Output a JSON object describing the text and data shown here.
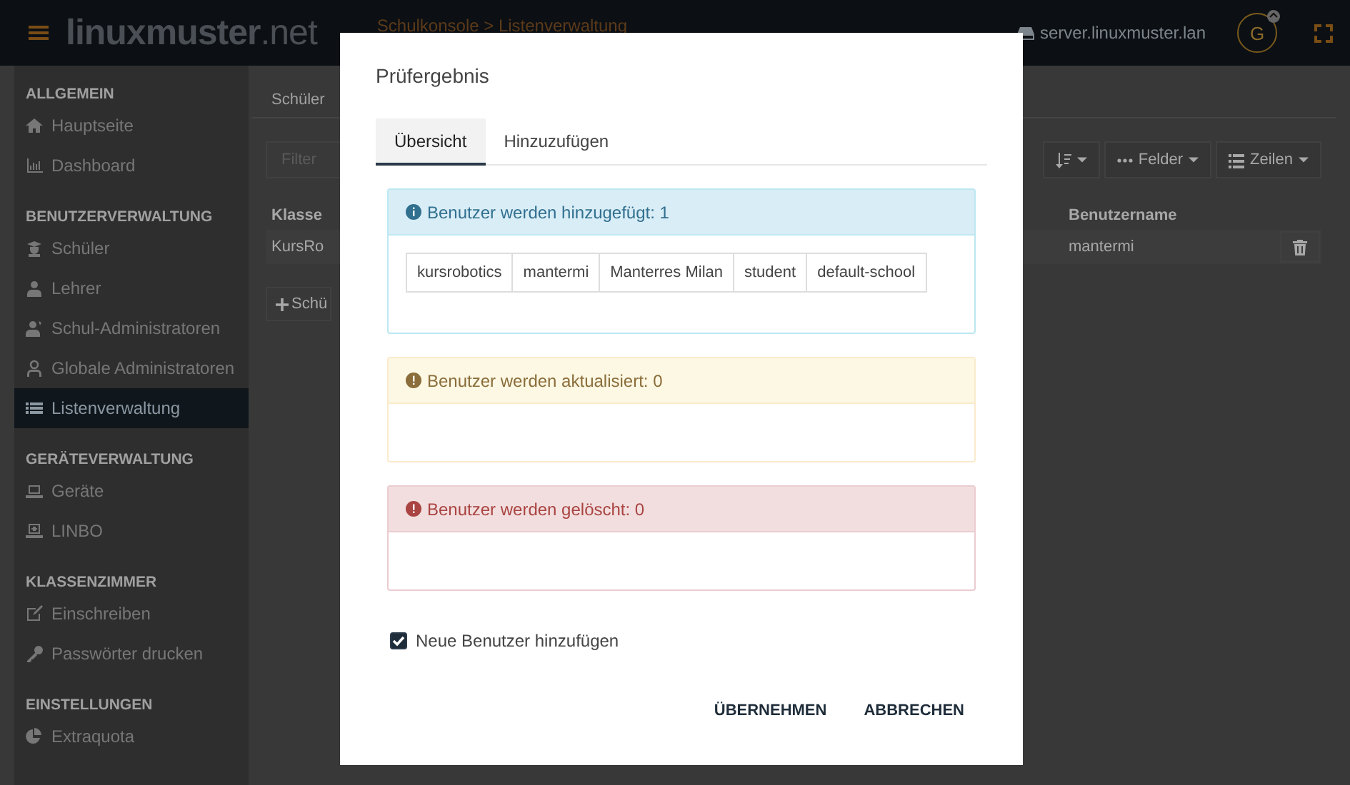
{
  "topbar": {
    "logo_main": "linuxmuster",
    "logo_suffix": ".net",
    "breadcrumb": "Schulkonsole > Listenverwaltung",
    "server": "server.linuxmuster.lan",
    "avatar": "G"
  },
  "sidebar": [
    {
      "heading": "ALLGEMEIN",
      "items": [
        {
          "label": "Hauptseite",
          "selected": false
        },
        {
          "label": "Dashboard",
          "selected": false
        }
      ]
    },
    {
      "heading": "BENUTZERVERWALTUNG",
      "items": [
        {
          "label": "Schüler",
          "selected": false
        },
        {
          "label": "Lehrer",
          "selected": false
        },
        {
          "label": "Schul-Administratoren",
          "selected": false
        },
        {
          "label": "Globale Administratoren",
          "selected": false
        },
        {
          "label": "Listenverwaltung",
          "selected": true
        }
      ]
    },
    {
      "heading": "GERÄTEVERWALTUNG",
      "items": [
        {
          "label": "Geräte",
          "selected": false
        },
        {
          "label": "LINBO",
          "selected": false
        }
      ]
    },
    {
      "heading": "KLASSENZIMMER",
      "items": [
        {
          "label": "Einschreiben",
          "selected": false
        },
        {
          "label": "Passwörter drucken",
          "selected": false
        }
      ]
    },
    {
      "heading": "EINSTELLUNGEN",
      "items": [
        {
          "label": "Extraquota",
          "selected": false
        }
      ]
    }
  ],
  "main": {
    "tab": "Schüler",
    "filter_placeholder": "Filter",
    "fields_button": "Felder",
    "rows_button": "Zeilen",
    "columns": [
      "Klasse",
      "Benutzername"
    ],
    "row": [
      "KursRo",
      "mantermi"
    ],
    "add_button": "Schü"
  },
  "dialog": {
    "title": "Prüfergebnis",
    "tabs": [
      {
        "label": "Übersicht",
        "selected": true
      },
      {
        "label": "Hinzuzufügen",
        "selected": false
      }
    ],
    "panels": [
      {
        "kind": "info",
        "title": "Benutzer werden hinzugefügt: 1",
        "rows": [
          [
            "kursrobotics",
            "mantermi",
            "Manterres Milan",
            "student",
            "default-school"
          ]
        ]
      },
      {
        "kind": "warning",
        "title": "Benutzer werden aktualisiert: 0"
      },
      {
        "kind": "danger",
        "title": "Benutzer werden gelöscht: 0"
      }
    ],
    "checkbox": {
      "label": "Neue Benutzer hinzufügen",
      "checked": true
    },
    "buttons": [
      "ÜBERNEHMEN",
      "ABBRECHEN"
    ]
  }
}
